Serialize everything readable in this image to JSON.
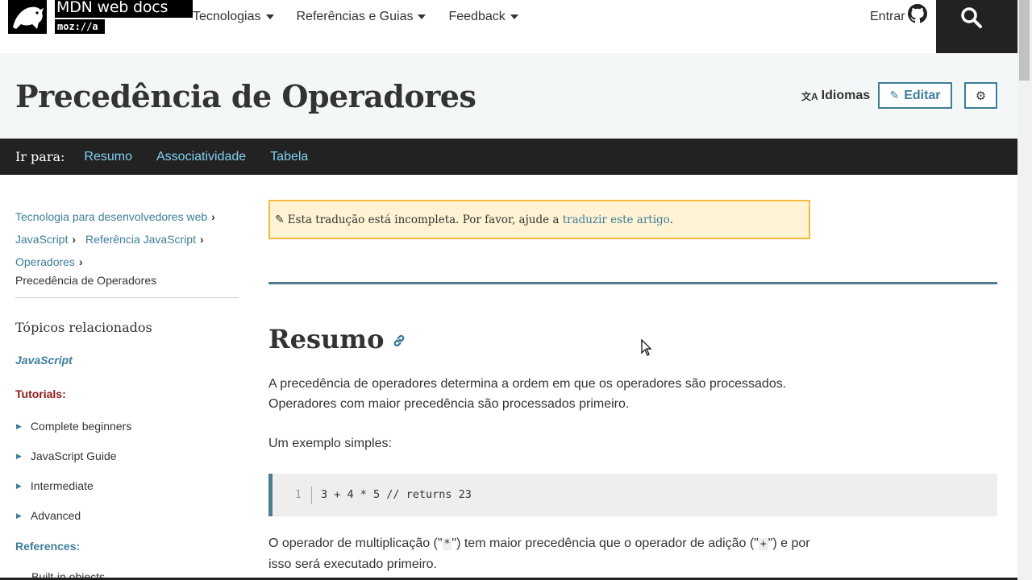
{
  "header": {
    "logo_title": "MDN web docs",
    "logo_sub": "moz://a",
    "nav": [
      {
        "label": "Tecnologias"
      },
      {
        "label": "Referências e Guias"
      },
      {
        "label": "Feedback"
      }
    ],
    "signin_label": "Entrar",
    "icons": {
      "signin": "github-icon",
      "search": "search-icon",
      "logo": "mdn-dino-icon"
    }
  },
  "titlebar": {
    "title": "Precedência de Operadores",
    "languages_label": "Idiomas",
    "edit_label": "Editar",
    "settings_icon": "gear-icon"
  },
  "jumpbar": {
    "label": "Ir para:",
    "links": [
      "Resumo",
      "Associatividade",
      "Tabela"
    ]
  },
  "sidebar": {
    "breadcrumbs": [
      "Tecnologia para desenvolvedores web",
      "JavaScript",
      "Referência JavaScript",
      "Operadores"
    ],
    "current": "Precedência de Operadores",
    "related_title": "Tópicos relacionados",
    "js_link": "JavaScript",
    "tutorials_title": "Tutorials:",
    "tutorials": [
      "Complete beginners",
      "JavaScript Guide",
      "Intermediate",
      "Advanced"
    ],
    "references_title": "References:",
    "references_first": "Built-in objects"
  },
  "content": {
    "notice_text": "Esta tradução está incompleta. Por favor, ajude a ",
    "notice_link": "traduzir este artigo",
    "notice_end": ".",
    "heading": "Resumo",
    "para1_line1": "A precedência de operadores determina a ordem em que os operadores são processados.",
    "para1_line2": "Operadores com maior precedência são processados primeiro.",
    "para2": "Um exemplo simples:",
    "code_line_number": "1",
    "code": "3 + 4 * 5 // returns 23",
    "para3_a": "O operador de multiplicação (\"",
    "para3_code1": "*",
    "para3_b": "\") tem maior precedência que o operador de adição (\"",
    "para3_code2": "+",
    "para3_c": "\") e por",
    "para3_line2": "isso será executado primeiro."
  }
}
